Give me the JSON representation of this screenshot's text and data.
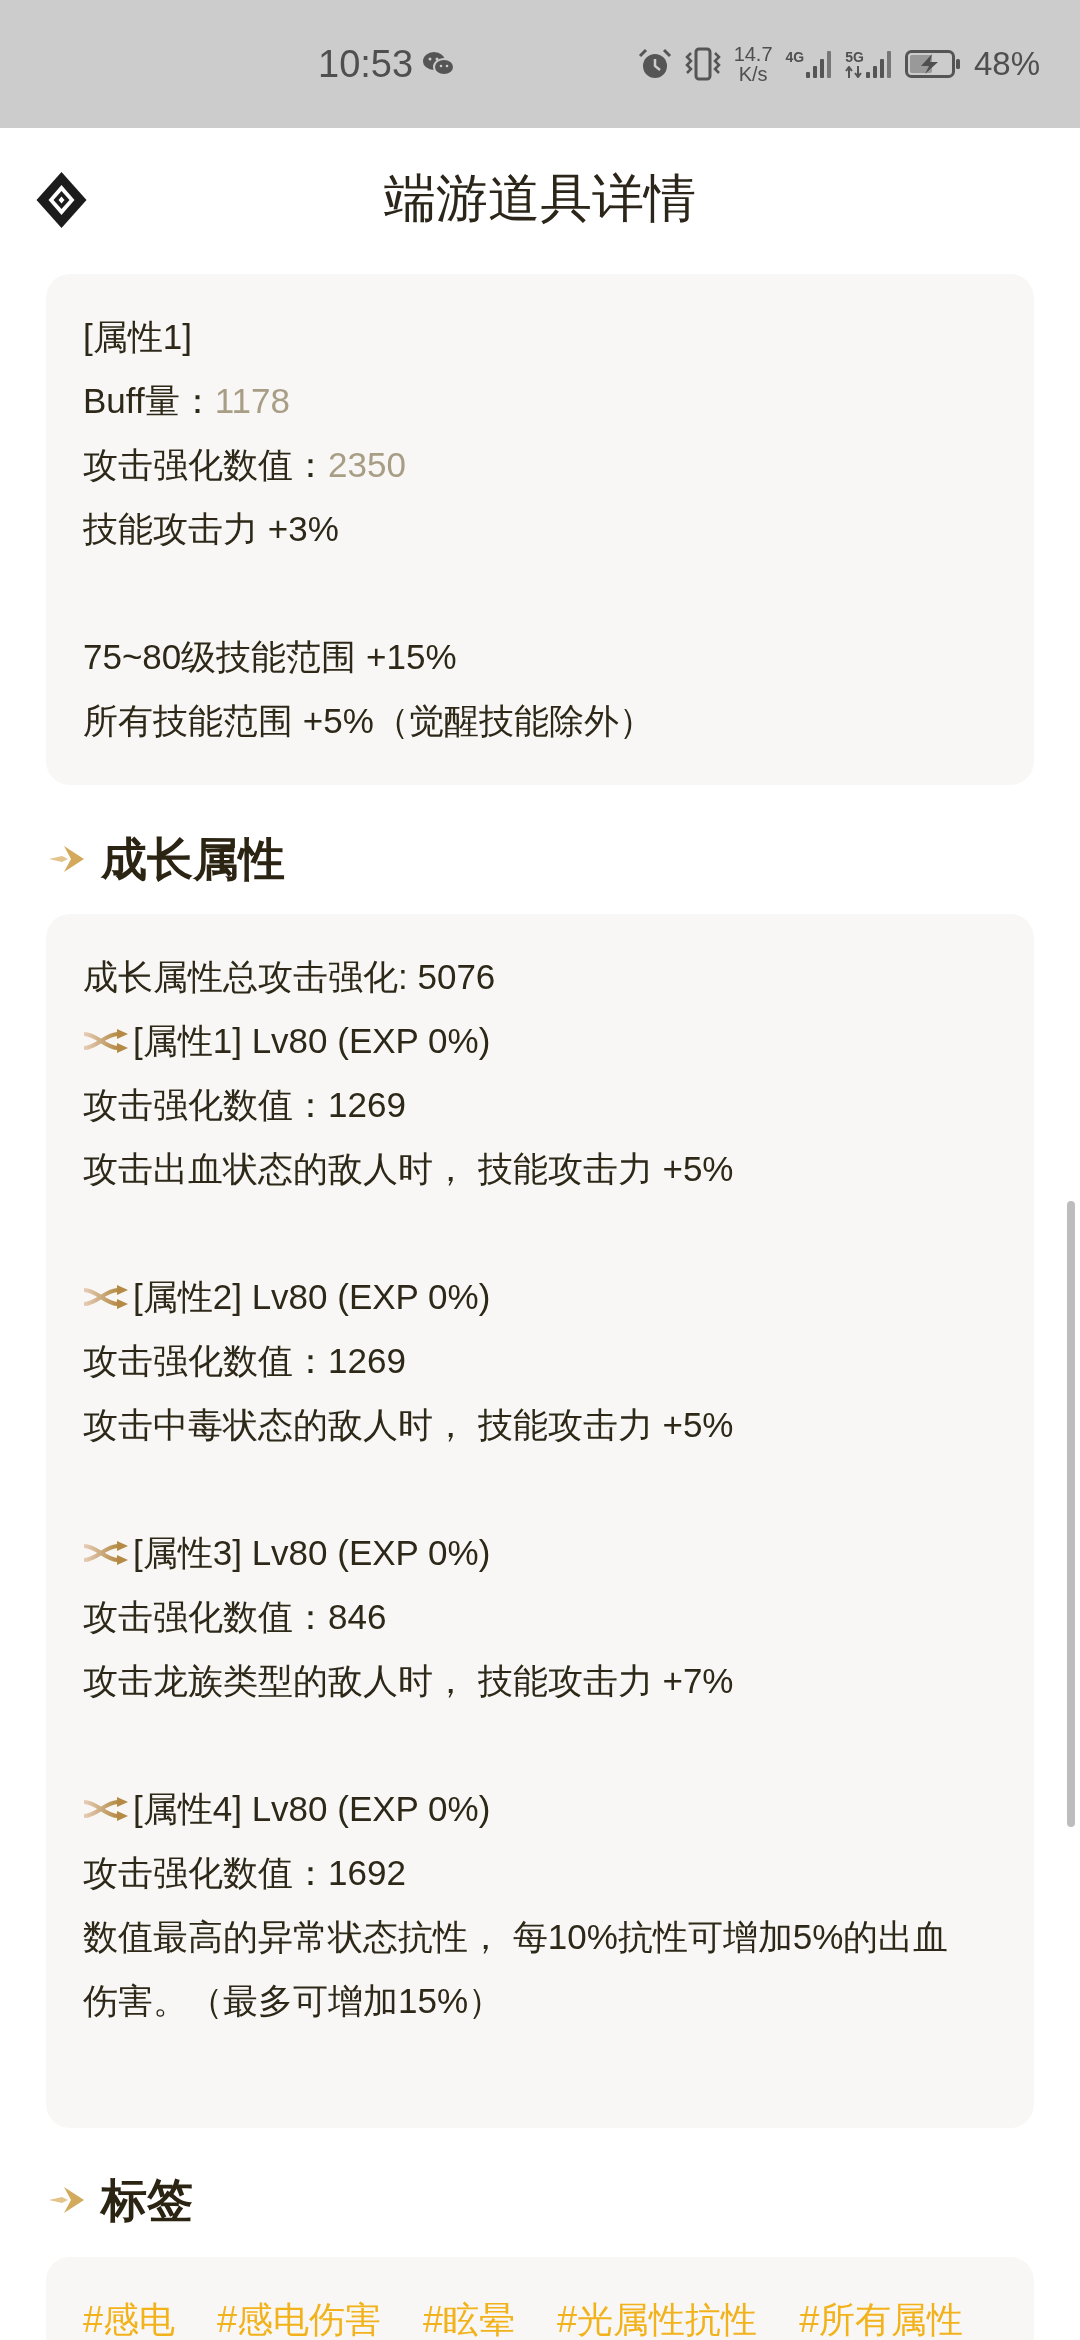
{
  "status_bar": {
    "time": "10:53",
    "speed_value": "14.7",
    "speed_unit": "K/s",
    "network_1": "4G",
    "network_2": "5G",
    "battery": "48%"
  },
  "header": {
    "title": "端游道具详情"
  },
  "attribute_card": {
    "paragraphs": [
      [
        {
          "kind": "text",
          "text": "[属性1]"
        },
        {
          "kind": "stat",
          "label": "Buff量：",
          "value": "1178"
        },
        {
          "kind": "stat",
          "label": "攻击强化数值：",
          "value": "2350"
        },
        {
          "kind": "text",
          "text": "技能攻击力 +3%"
        }
      ],
      [
        {
          "kind": "text",
          "text": "75~80级技能范围 +15%"
        },
        {
          "kind": "text",
          "text": "所有技能范围 +5%（觉醒技能除外）"
        }
      ]
    ]
  },
  "growth_section": {
    "title": "成长属性",
    "summary": "成长属性总攻击强化: 5076",
    "options": [
      {
        "title": "[属性1] Lv80 (EXP 0%)",
        "lines": [
          "攻击强化数值：1269",
          "攻击出血状态的敌人时， 技能攻击力 +5%"
        ]
      },
      {
        "title": "[属性2] Lv80 (EXP 0%)",
        "lines": [
          "攻击强化数值：1269",
          "攻击中毒状态的敌人时， 技能攻击力 +5%"
        ]
      },
      {
        "title": "[属性3] Lv80 (EXP 0%)",
        "lines": [
          "攻击强化数值：846",
          "攻击龙族类型的敌人时， 技能攻击力 +7%"
        ]
      },
      {
        "title": "[属性4] Lv80 (EXP 0%)",
        "lines": [
          "攻击强化数值：1692",
          "数值最高的异常状态抗性， 每10%抗性可增加5%的出血伤害。（最多可增加15%）"
        ]
      }
    ]
  },
  "tags_section": {
    "title": "标签",
    "tags": [
      "#感电",
      "#感电伤害",
      "#眩晕",
      "#光属性抗性",
      "#所有属性"
    ]
  }
}
